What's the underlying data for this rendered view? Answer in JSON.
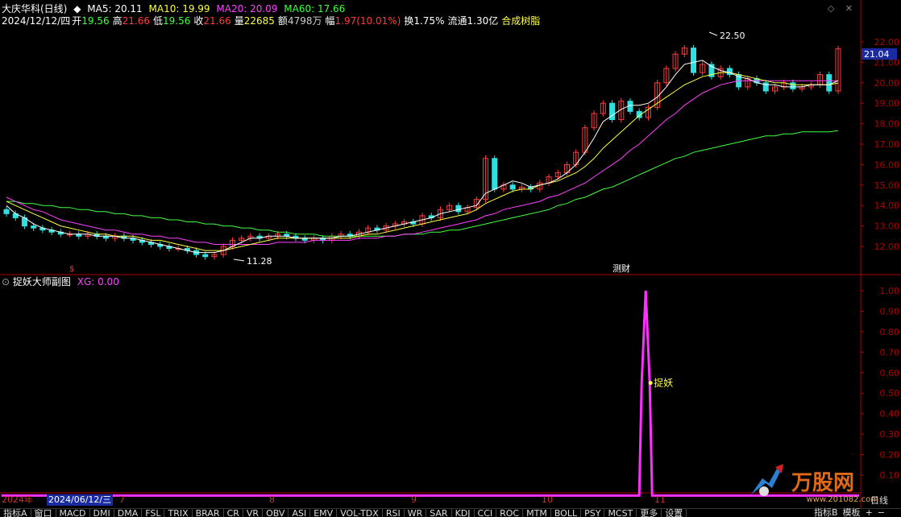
{
  "header": {
    "stock_name": "大庆华科(日线)",
    "ma5_label": "MA5: 20.11",
    "ma10_label": "MA10: 19.99",
    "ma20_label": "MA20: 20.09",
    "ma60_label": "MA60: 17.66",
    "date": "2024/12/12/四",
    "open_label": "开",
    "open": "19.56",
    "high_label": "高",
    "high": "21.66",
    "low_label": "低",
    "low": "19.56",
    "close_label": "收",
    "close": "21.66",
    "volume_label": "量",
    "volume": "22685",
    "amount_label": "额",
    "amount": "4798万",
    "change_label": "幅",
    "change": "1.97(10.01%)",
    "turnover_label": "换",
    "turnover": "1.75%",
    "float_label": "流通",
    "float": "1.30亿",
    "sector": "合成树脂"
  },
  "sub_panel": {
    "title": "捉妖大师副图",
    "xg_label": "XG: 0.00",
    "signal_label": "捉妖"
  },
  "annotations": {
    "high_marker": "22.50",
    "low_marker": "11.28",
    "last_price": "21.04",
    "event_marker": "测财"
  },
  "date_axis": {
    "year_label": "2024年",
    "selected_date": "2024/06/12/三",
    "months": [
      {
        "label": "7"
      },
      {
        "label": "8"
      },
      {
        "label": "9"
      },
      {
        "label": "10"
      },
      {
        "label": "11"
      }
    ]
  },
  "tabs": [
    "指标A",
    "窗口",
    "MACD",
    "DMI",
    "DMA",
    "FSL",
    "TRIX",
    "BRAR",
    "CR",
    "VR",
    "OBV",
    "ASI",
    "EMV",
    "VOL-TDX",
    "RSI",
    "WR",
    "SAR",
    "KDJ",
    "CCI",
    "ROC",
    "MTM",
    "BOLL",
    "PSY",
    "MCST",
    "更多",
    "设置"
  ],
  "right_tabs": [
    "指标B",
    "模板",
    "+",
    "−"
  ],
  "right_label": "日线",
  "watermark": {
    "brand": "万股网",
    "url": "www.201082.com"
  },
  "colors": {
    "up": "#ff3b3b",
    "down": "#30e0e0",
    "ma5": "#ffffff",
    "ma10": "#ffff40",
    "ma20": "#ff40ff",
    "ma60": "#40ff40",
    "sub_line": "#ff30ff",
    "axis": "#b00000"
  },
  "chart_data": [
    {
      "type": "candlestick",
      "title": "大庆华科(日线)",
      "y_axis_ticks": [
        22.0,
        21.0,
        20.0,
        19.0,
        18.0,
        17.0,
        16.0,
        15.0,
        14.0,
        13.0,
        12.0
      ],
      "ylim": [
        11.2,
        22.6
      ],
      "close_series": [
        13.6,
        13.4,
        13.0,
        12.9,
        12.8,
        12.7,
        12.6,
        12.6,
        12.5,
        12.6,
        12.5,
        12.4,
        12.5,
        12.4,
        12.3,
        12.2,
        12.1,
        12.0,
        11.9,
        11.9,
        11.8,
        11.6,
        11.5,
        11.6,
        12.0,
        12.3,
        12.4,
        12.5,
        12.4,
        12.5,
        12.6,
        12.5,
        12.4,
        12.3,
        12.4,
        12.3,
        12.5,
        12.6,
        12.5,
        12.7,
        12.9,
        12.8,
        13.0,
        13.1,
        13.2,
        13.1,
        13.5,
        13.4,
        13.8,
        14.0,
        13.7,
        13.9,
        14.3,
        16.3,
        14.8,
        15.0,
        14.8,
        14.9,
        14.8,
        15.1,
        15.4,
        15.6,
        16.0,
        16.6,
        17.8,
        18.5,
        19.0,
        18.2,
        19.1,
        18.6,
        18.3,
        18.8,
        20.0,
        20.7,
        21.4,
        21.7,
        20.5,
        20.9,
        20.3,
        20.7,
        20.4,
        19.8,
        20.2,
        20.0,
        19.6,
        19.8,
        20.0,
        19.7,
        19.8,
        19.9,
        20.4,
        19.6,
        21.66
      ],
      "ma5": [
        14.0,
        13.6,
        13.4,
        13.1,
        12.9,
        12.8,
        12.7,
        12.6,
        12.6,
        12.6,
        12.5,
        12.5,
        12.5,
        12.4,
        12.4,
        12.3,
        12.2,
        12.1,
        12.0,
        11.9,
        11.8,
        11.7,
        11.7,
        11.7,
        11.8,
        12.0,
        12.2,
        12.4,
        12.4,
        12.5,
        12.5,
        12.5,
        12.4,
        12.4,
        12.4,
        12.4,
        12.4,
        12.5,
        12.5,
        12.6,
        12.7,
        12.8,
        12.9,
        13.0,
        13.1,
        13.2,
        13.3,
        13.4,
        13.6,
        13.7,
        13.8,
        13.9,
        14.0,
        14.6,
        14.8,
        15.0,
        15.2,
        15.1,
        14.9,
        15.0,
        15.1,
        15.3,
        15.6,
        16.0,
        16.6,
        17.3,
        18.1,
        18.4,
        18.7,
        18.9,
        18.9,
        19.0,
        19.3,
        19.8,
        20.4,
        20.9,
        21.0,
        21.1,
        20.8,
        20.6,
        20.5,
        20.3,
        20.2,
        20.0,
        19.9,
        19.9,
        19.8,
        19.8,
        19.8,
        19.9,
        19.9,
        19.9,
        20.11
      ],
      "ma10": [
        14.2,
        14.0,
        13.8,
        13.6,
        13.4,
        13.2,
        13.0,
        12.9,
        12.8,
        12.7,
        12.6,
        12.6,
        12.5,
        12.5,
        12.5,
        12.4,
        12.3,
        12.3,
        12.2,
        12.1,
        12.0,
        11.9,
        11.8,
        11.8,
        11.8,
        11.9,
        12.0,
        12.1,
        12.2,
        12.3,
        12.4,
        12.4,
        12.4,
        12.4,
        12.4,
        12.4,
        12.4,
        12.4,
        12.4,
        12.5,
        12.6,
        12.6,
        12.7,
        12.8,
        12.9,
        13.0,
        13.1,
        13.2,
        13.3,
        13.4,
        13.5,
        13.6,
        13.8,
        14.1,
        14.3,
        14.5,
        14.7,
        14.8,
        14.8,
        15.0,
        15.1,
        15.2,
        15.4,
        15.6,
        15.9,
        16.3,
        16.8,
        17.2,
        17.6,
        18.0,
        18.4,
        18.7,
        19.0,
        19.3,
        19.6,
        19.9,
        20.1,
        20.3,
        20.4,
        20.5,
        20.5,
        20.4,
        20.3,
        20.2,
        20.1,
        20.0,
        20.0,
        19.9,
        19.9,
        19.9,
        19.9,
        19.9,
        19.99
      ],
      "ma20": [
        14.4,
        14.2,
        14.0,
        13.8,
        13.7,
        13.5,
        13.3,
        13.2,
        13.1,
        13.0,
        12.9,
        12.8,
        12.8,
        12.7,
        12.6,
        12.6,
        12.5,
        12.5,
        12.4,
        12.4,
        12.3,
        12.2,
        12.2,
        12.1,
        12.1,
        12.1,
        12.1,
        12.1,
        12.1,
        12.1,
        12.2,
        12.2,
        12.2,
        12.2,
        12.3,
        12.3,
        12.3,
        12.3,
        12.3,
        12.4,
        12.4,
        12.4,
        12.5,
        12.5,
        12.6,
        12.6,
        12.7,
        12.8,
        12.9,
        13.0,
        13.1,
        13.2,
        13.3,
        13.5,
        13.6,
        13.8,
        13.9,
        14.0,
        14.1,
        14.2,
        14.4,
        14.5,
        14.7,
        14.9,
        15.1,
        15.4,
        15.7,
        16.0,
        16.3,
        16.7,
        17.0,
        17.4,
        17.8,
        18.2,
        18.5,
        18.9,
        19.2,
        19.5,
        19.7,
        19.9,
        20.0,
        20.1,
        20.1,
        20.1,
        20.1,
        20.1,
        20.1,
        20.1,
        20.1,
        20.1,
        20.1,
        20.1,
        20.09
      ],
      "ma60": [
        14.2,
        14.2,
        14.1,
        14.1,
        14.0,
        14.0,
        13.9,
        13.9,
        13.8,
        13.8,
        13.7,
        13.7,
        13.6,
        13.6,
        13.5,
        13.5,
        13.4,
        13.4,
        13.3,
        13.3,
        13.2,
        13.2,
        13.1,
        13.1,
        13.0,
        13.0,
        12.9,
        12.9,
        12.8,
        12.8,
        12.7,
        12.7,
        12.6,
        12.6,
        12.6,
        12.5,
        12.5,
        12.5,
        12.5,
        12.5,
        12.5,
        12.5,
        12.5,
        12.5,
        12.6,
        12.6,
        12.6,
        12.7,
        12.7,
        12.8,
        12.8,
        12.9,
        13.0,
        13.1,
        13.2,
        13.3,
        13.4,
        13.5,
        13.6,
        13.7,
        13.8,
        14.0,
        14.1,
        14.3,
        14.4,
        14.6,
        14.8,
        14.9,
        15.1,
        15.3,
        15.5,
        15.7,
        15.9,
        16.1,
        16.3,
        16.4,
        16.6,
        16.7,
        16.8,
        16.9,
        17.0,
        17.1,
        17.2,
        17.3,
        17.4,
        17.4,
        17.5,
        17.5,
        17.6,
        17.6,
        17.6,
        17.6,
        17.66
      ]
    },
    {
      "type": "line",
      "title": "捉妖大师副图",
      "y_axis_ticks": [
        1.0,
        0.9,
        0.8,
        0.7,
        0.6,
        0.5,
        0.4,
        0.3,
        0.2,
        0.1
      ],
      "ylim": [
        0,
        1.05
      ],
      "series": [
        {
          "name": "XG",
          "spike_index": 70,
          "spike_value": 1.0,
          "base_value": 0.0
        }
      ],
      "annotation": {
        "text": "捉妖",
        "y": 0.55
      }
    }
  ]
}
